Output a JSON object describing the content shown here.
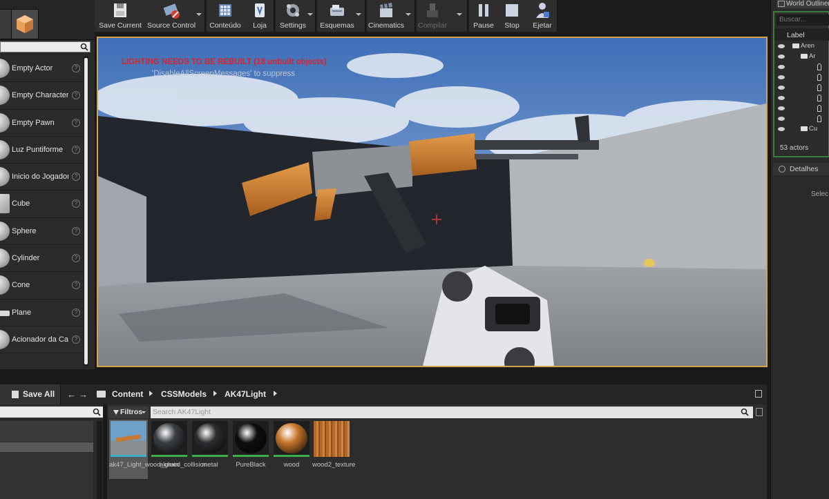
{
  "left_panel": {
    "actors": [
      {
        "label": "Empty Actor",
        "thumb": "sphere"
      },
      {
        "label": "Empty Character",
        "thumb": "sphere"
      },
      {
        "label": "Empty Pawn",
        "thumb": "sphere"
      },
      {
        "label": "Luz Puntiforme",
        "thumb": "sphere"
      },
      {
        "label": "Inicio do Jogador",
        "thumb": "sphere"
      },
      {
        "label": "Cube",
        "thumb": "box"
      },
      {
        "label": "Sphere",
        "thumb": "sphere"
      },
      {
        "label": "Cylinder",
        "thumb": "sphere"
      },
      {
        "label": "Cone",
        "thumb": "sphere"
      },
      {
        "label": "Plane",
        "thumb": "flat"
      },
      {
        "label": "Acionador da Cai",
        "thumb": "sphere"
      }
    ]
  },
  "toolbar": {
    "buttons": [
      {
        "label": "Save Current",
        "icon": "floppy-icon"
      },
      {
        "label": "Source Control",
        "icon": "source-control-icon"
      },
      {
        "label": "Conteúdo",
        "icon": "content-icon"
      },
      {
        "label": "Loja",
        "icon": "marketplace-icon"
      },
      {
        "label": "Settings",
        "icon": "settings-icon"
      },
      {
        "label": "Esquemas",
        "icon": "blueprints-icon"
      },
      {
        "label": "Cinematics",
        "icon": "clapper-icon"
      },
      {
        "label": "Compilar",
        "icon": "compile-icon"
      },
      {
        "label": "Pause",
        "icon": "pause-icon"
      },
      {
        "label": "Stop",
        "icon": "stop-icon"
      },
      {
        "label": "Ejetar",
        "icon": "eject-icon"
      }
    ]
  },
  "viewport": {
    "warning": "LIGHTING NEEDS TO BE REBUILT (18 unbuilt objects)",
    "hint": "'DisableAllScreenMessages' to suppress"
  },
  "world_outliner": {
    "tab": "World Outliner",
    "search_placeholder": "Buscar...",
    "column": "Label",
    "rows": [
      {
        "text": "Aren",
        "kind": "folder"
      },
      {
        "text": "Ar",
        "kind": "folder"
      },
      {
        "text": "",
        "kind": "pawn"
      },
      {
        "text": "",
        "kind": "pawn"
      },
      {
        "text": "",
        "kind": "pawn"
      },
      {
        "text": "",
        "kind": "pawn"
      },
      {
        "text": "",
        "kind": "pawn"
      },
      {
        "text": "",
        "kind": "pawn"
      },
      {
        "text": "Cu",
        "kind": "folder"
      }
    ],
    "count": "53 actors"
  },
  "details": {
    "tab": "Detalhes",
    "hint": "Selec"
  },
  "content_browser": {
    "save_all": "Save All",
    "path": [
      "Content",
      "CSSModels",
      "AK47Light"
    ],
    "filters": "Filtros",
    "search_placeholder": "Search AK47Light",
    "assets": [
      {
        "name": "ak47_Light_wood_glued_collision",
        "type": "mesh",
        "selected": true
      },
      {
        "name": "alumin",
        "type": "material",
        "color": "#3b3f44"
      },
      {
        "name": "metal",
        "type": "material",
        "color": "#2b2d30"
      },
      {
        "name": "PureBlack",
        "type": "material",
        "color": "#0e0e0e"
      },
      {
        "name": "wood",
        "type": "material",
        "color": "#c8772c"
      },
      {
        "name": "wood2_texture",
        "type": "texture",
        "color": "#b3692b"
      }
    ]
  }
}
